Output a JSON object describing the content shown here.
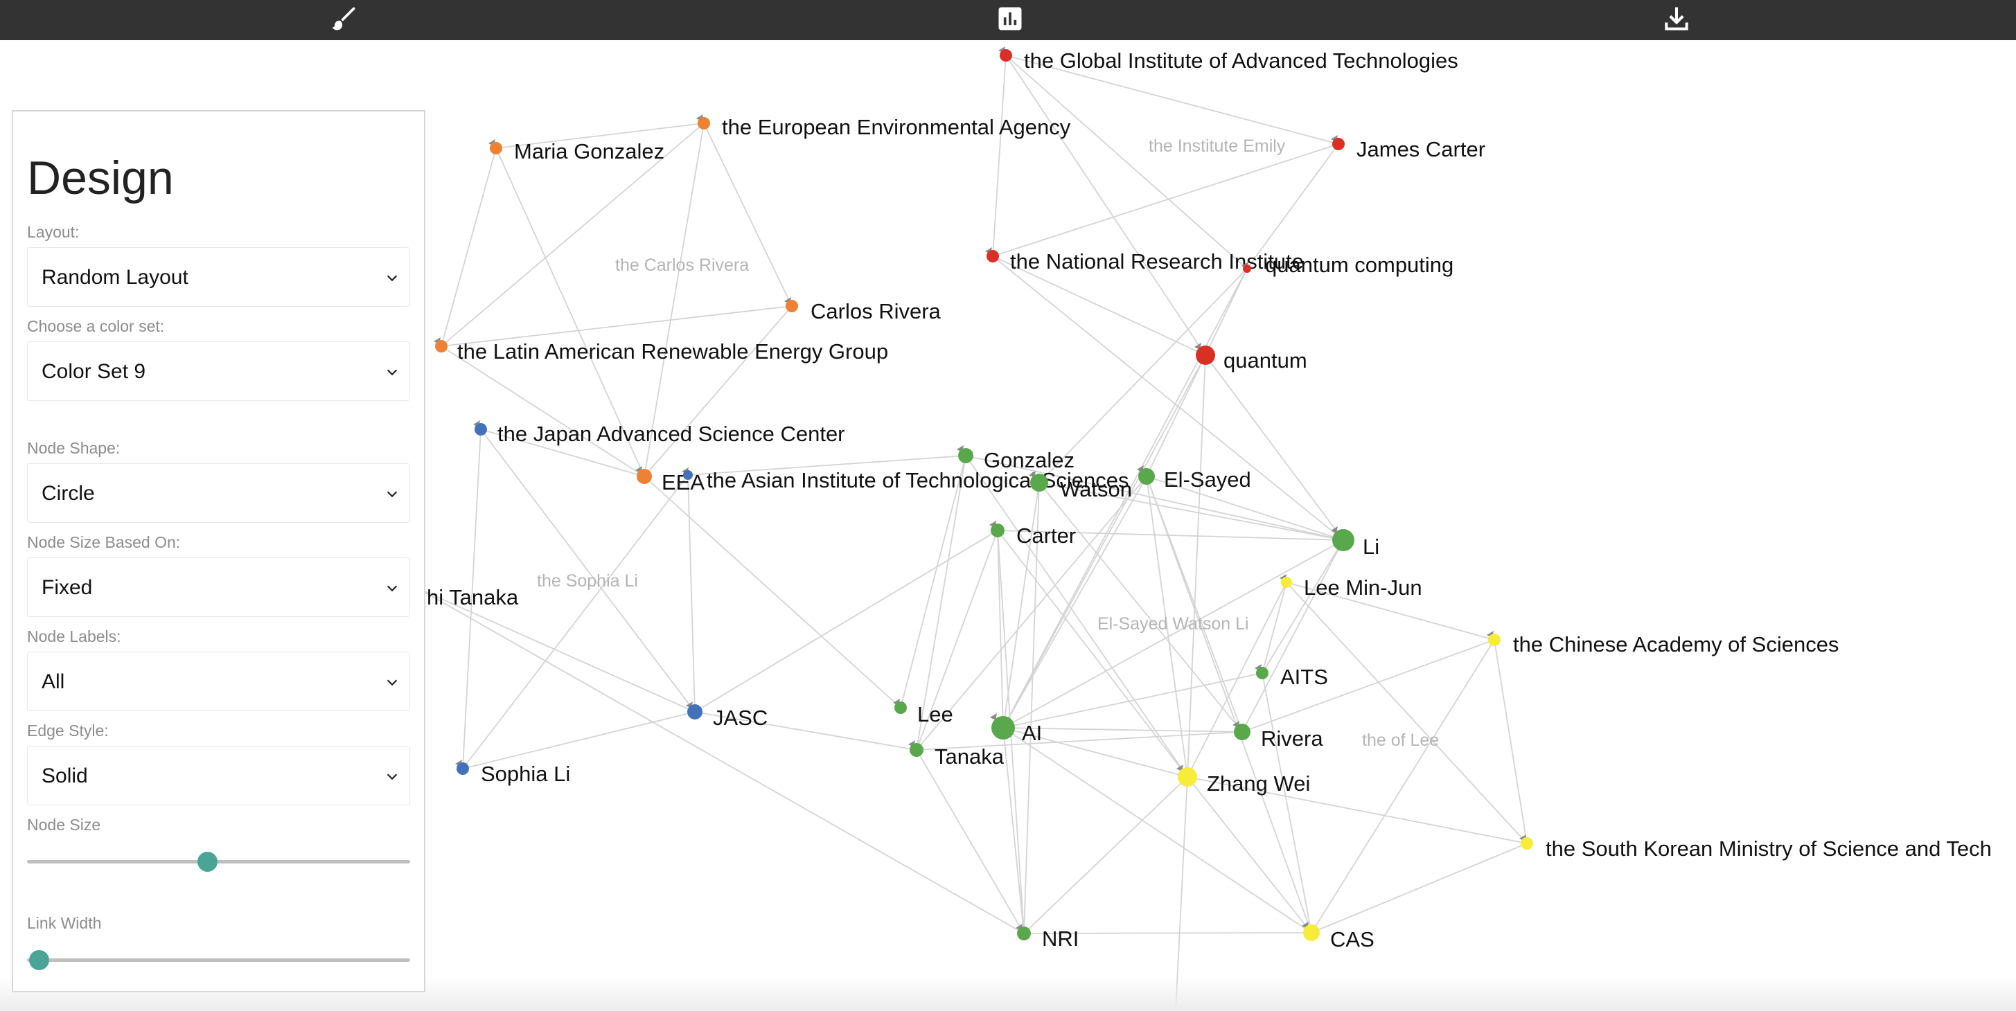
{
  "toolbar": {
    "buttons": [
      {
        "name": "design-button",
        "icon": "paintbrush-icon"
      },
      {
        "name": "statistics-button",
        "icon": "chart-icon"
      },
      {
        "name": "download-button",
        "icon": "download-icon"
      }
    ],
    "background": "#333333"
  },
  "panel": {
    "title": "Design",
    "layout": {
      "label": "Layout:",
      "value": "Random Layout"
    },
    "color_set": {
      "label": "Choose a color set:",
      "value": "Color Set 9"
    },
    "node_shape": {
      "label": "Node Shape:",
      "value": "Circle"
    },
    "node_size_based_on": {
      "label": "Node Size Based On:",
      "value": "Fixed"
    },
    "node_labels": {
      "label": "Node Labels:",
      "value": "All"
    },
    "edge_style": {
      "label": "Edge Style:",
      "value": "Solid"
    },
    "node_size": {
      "label": "Node Size",
      "value": 0.47
    },
    "link_width": {
      "label": "Link Width",
      "value": 0.03
    },
    "accent": "#4aa597"
  },
  "graph": {
    "colors": {
      "red": "#d93025",
      "orange": "#ee8133",
      "blue": "#4472b8",
      "green": "#5aa84c",
      "yellow": "#f7ec3a",
      "edge": "#d4d4d4",
      "edge_label": "#b5b5b5"
    },
    "nodes": [
      {
        "id": "gi",
        "label": "the Global Institute of Advanced Technologies",
        "color": "red"
      },
      {
        "id": "jc",
        "label": "James Carter",
        "color": "red"
      },
      {
        "id": "nri_full",
        "label": "the National Research Institute",
        "color": "red"
      },
      {
        "id": "qc",
        "label": "quantum computing",
        "color": "red"
      },
      {
        "id": "quantum",
        "label": "quantum",
        "color": "red"
      },
      {
        "id": "mg",
        "label": "Maria Gonzalez",
        "color": "orange"
      },
      {
        "id": "eea_full",
        "label": "the European Environmental Agency",
        "color": "orange"
      },
      {
        "id": "cr",
        "label": "Carlos Rivera",
        "color": "orange"
      },
      {
        "id": "lar",
        "label": "the Latin American Renewable Energy Group",
        "color": "orange"
      },
      {
        "id": "eea",
        "label": "EEA",
        "color": "orange"
      },
      {
        "id": "jasc_full",
        "label": "the Japan Advanced Science Center",
        "color": "blue"
      },
      {
        "id": "aits_full",
        "label": "the Asian Institute of Technological Sciences",
        "color": "blue"
      },
      {
        "id": "tanaka_full",
        "label": "hi Tanaka",
        "color": "blue"
      },
      {
        "id": "jasc",
        "label": "JASC",
        "color": "blue"
      },
      {
        "id": "sl",
        "label": "Sophia Li",
        "color": "blue"
      },
      {
        "id": "gonzalez",
        "label": "Gonzalez",
        "color": "green"
      },
      {
        "id": "watson",
        "label": "Watson",
        "color": "green"
      },
      {
        "id": "elsayed",
        "label": "El-Sayed",
        "color": "green"
      },
      {
        "id": "carter",
        "label": "Carter",
        "color": "green"
      },
      {
        "id": "li",
        "label": "Li",
        "color": "green"
      },
      {
        "id": "aits",
        "label": "AITS",
        "color": "green"
      },
      {
        "id": "lee",
        "label": "Lee",
        "color": "green"
      },
      {
        "id": "ai",
        "label": "AI",
        "color": "green"
      },
      {
        "id": "rivera",
        "label": "Rivera",
        "color": "green"
      },
      {
        "id": "tanaka",
        "label": "Tanaka",
        "color": "green"
      },
      {
        "id": "nri",
        "label": "NRI",
        "color": "green"
      },
      {
        "id": "lmj",
        "label": "Lee Min-Jun",
        "color": "yellow"
      },
      {
        "id": "cas_full",
        "label": "the Chinese Academy of Sciences",
        "color": "yellow"
      },
      {
        "id": "zw",
        "label": "Zhang Wei",
        "color": "yellow"
      },
      {
        "id": "skm",
        "label": "the South Korean Ministry of Science and Tech",
        "color": "yellow"
      },
      {
        "id": "cas",
        "label": "CAS",
        "color": "yellow"
      }
    ],
    "edge_labels": [
      "the Institute Emily",
      "the Carlos Rivera",
      "the Sophia Li",
      "El-Sayed Watson Li",
      "the of Lee"
    ]
  }
}
